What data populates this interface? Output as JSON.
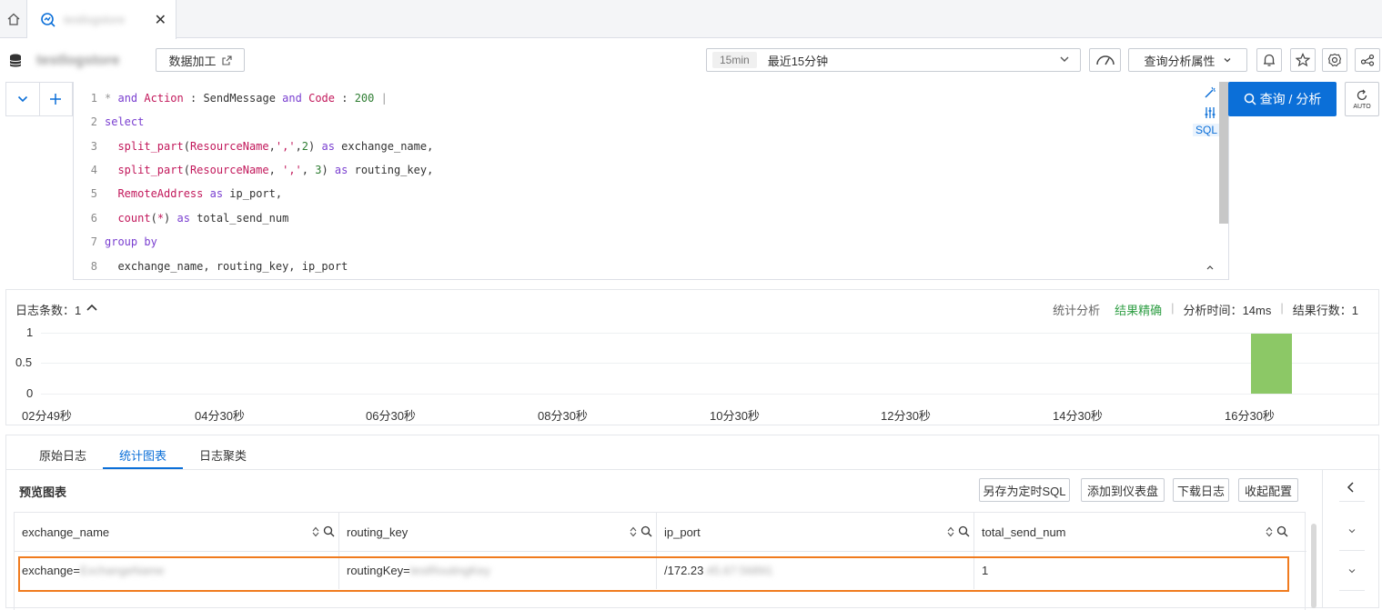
{
  "tabs": {
    "active_title": "testlogstore"
  },
  "toolbar": {
    "logstore_name": "testlogstore",
    "data_transform_label": "数据加工",
    "time_pill": "15min",
    "time_label": "最近15分钟",
    "query_attr_label": "查询分析属性"
  },
  "editor": {
    "sql_badge": "SQL",
    "lines": [
      {
        "n": "1"
      },
      {
        "n": "2"
      },
      {
        "n": "3"
      },
      {
        "n": "4"
      },
      {
        "n": "5"
      },
      {
        "n": "6"
      },
      {
        "n": "7"
      },
      {
        "n": "8"
      }
    ],
    "line1": {
      "star": "*",
      "and1": "and",
      "field1": "Action",
      "colon1": ":",
      "val1": "SendMessage",
      "and2": "and",
      "field2": "Code",
      "colon2": ":",
      "val2": "200",
      "pipe": "|"
    },
    "line2": {
      "kw": "select"
    },
    "line3": {
      "fn": "split_part",
      "arg1": "ResourceName",
      "arg2": "','",
      "arg3": "2",
      "as": "as",
      "alias": "exchange_name,"
    },
    "line4": {
      "fn": "split_part",
      "arg1": "ResourceName",
      "arg2": "','",
      "arg3": "3",
      "as": "as",
      "alias": "routing_key,"
    },
    "line5": {
      "field": "RemoteAddress",
      "as": "as",
      "alias": "ip_port,"
    },
    "line6": {
      "fn": "count",
      "arg": "*",
      "as": "as",
      "alias": "total_send_num"
    },
    "line7": {
      "kw": "group by"
    },
    "line8": {
      "text": "exchange_name, routing_key, ip_port"
    }
  },
  "search_button_label": "查询 / 分析",
  "auto_label": "AUTO",
  "histogram": {
    "count_label": "日志条数：",
    "count_value": "1",
    "stats_label": "统计分析",
    "precise_label": "结果精确",
    "analysis_time_label": "分析时间：",
    "analysis_time_value": "14ms",
    "result_rows_label": "结果行数：",
    "result_rows_value": "1",
    "y_ticks": [
      "1",
      "0.5",
      "0"
    ],
    "x_ticks": [
      "02分49秒",
      "04分30秒",
      "06分30秒",
      "08分30秒",
      "10分30秒",
      "12分30秒",
      "14分30秒",
      "16分30秒"
    ],
    "bar_color": "#8cc866"
  },
  "lower": {
    "tab_raw": "原始日志",
    "tab_stats": "统计图表",
    "tab_cluster": "日志聚类",
    "preview_title": "预览图表",
    "btn_save_sql": "另存为定时SQL",
    "btn_add_dashboard": "添加到仪表盘",
    "btn_download": "下载日志",
    "btn_collapse": "收起配置"
  },
  "table": {
    "columns": [
      "exchange_name",
      "routing_key",
      "ip_port",
      "total_send_num"
    ],
    "row": {
      "exchange_prefix": "exchange=",
      "exchange_hidden": "ExchangeName",
      "routing_prefix": "routingKey=",
      "routing_hidden": "testRoutingKey",
      "ip_prefix": "/172.23",
      "ip_hidden": ".45.67:56891",
      "total": "1"
    }
  },
  "colors": {
    "accent": "#0b6fd8",
    "highlight": "#f07b1e",
    "success": "#2f9e44"
  }
}
